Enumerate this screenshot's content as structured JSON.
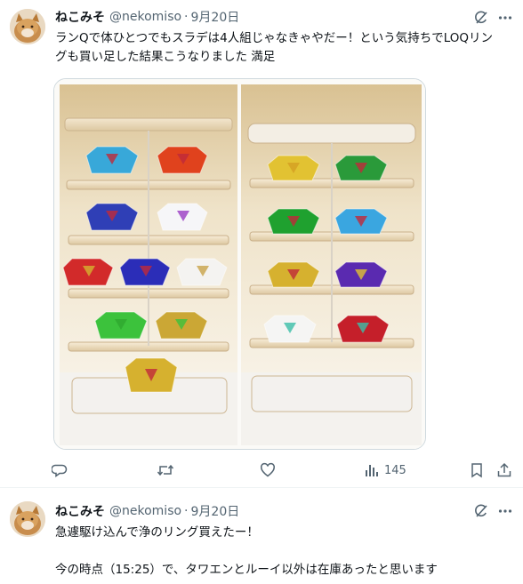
{
  "tweets": [
    {
      "display_name": "ねこみそ",
      "handle": "@nekomiso",
      "separator": "·",
      "date": "9月20日",
      "text_line1": "ランQで体ひとつでもスラデは4人組じゃなきゃやだー！という気持ちでLOQリン",
      "text_line2": "グも買い足した結果こうなりました 満足",
      "stats": {
        "views": "145"
      }
    },
    {
      "display_name": "ねこみそ",
      "handle": "@nekomiso",
      "separator": "·",
      "date": "9月20日",
      "text_line1": "急遽駆け込んで浄のリング買えたー！",
      "text_line2": "今の時点（15:25）で、タワエンとルーイ以外は在庫あったと思います"
    }
  ],
  "icons": {
    "grok": "grok-icon",
    "more": "more-icon",
    "reply": "reply-icon",
    "retweet": "retweet-icon",
    "like": "like-icon",
    "views": "views-icon",
    "bookmark": "bookmark-icon",
    "share": "share-icon"
  },
  "colors": {
    "secondary_text": "#536471",
    "border": "#cfd9de"
  }
}
